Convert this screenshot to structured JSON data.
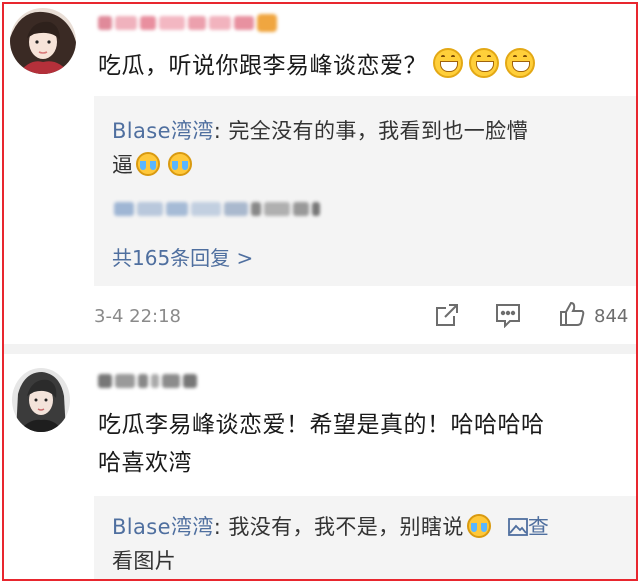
{
  "comments": [
    {
      "text": "吃瓜，听说你跟李易峰谈恋爱？",
      "emoji_icons": [
        "grin-emoji-icon",
        "grin-emoji-icon",
        "grin-emoji-icon"
      ],
      "reply": {
        "author": "Blase湾湾",
        "separator": ": ",
        "text_line1": "完全没有的事，我看到也一脸懵",
        "text_line2": "逼"
      },
      "more_replies": "共165条回复 >",
      "time": "3-4 22:18",
      "likes": "844"
    },
    {
      "text_line1": "吃瓜李易峰谈恋爱！希望是真的！哈哈哈哈",
      "text_line2": "哈喜欢湾",
      "reply": {
        "author": "Blase湾湾",
        "separator": ": ",
        "text": "我没有，我不是，别瞎说",
        "link_line1": "查",
        "link_line2": "看图片"
      }
    }
  ],
  "colors": {
    "border": "#e8262e",
    "link": "#4f6f9f",
    "reply_bg": "#f4f4f4"
  }
}
